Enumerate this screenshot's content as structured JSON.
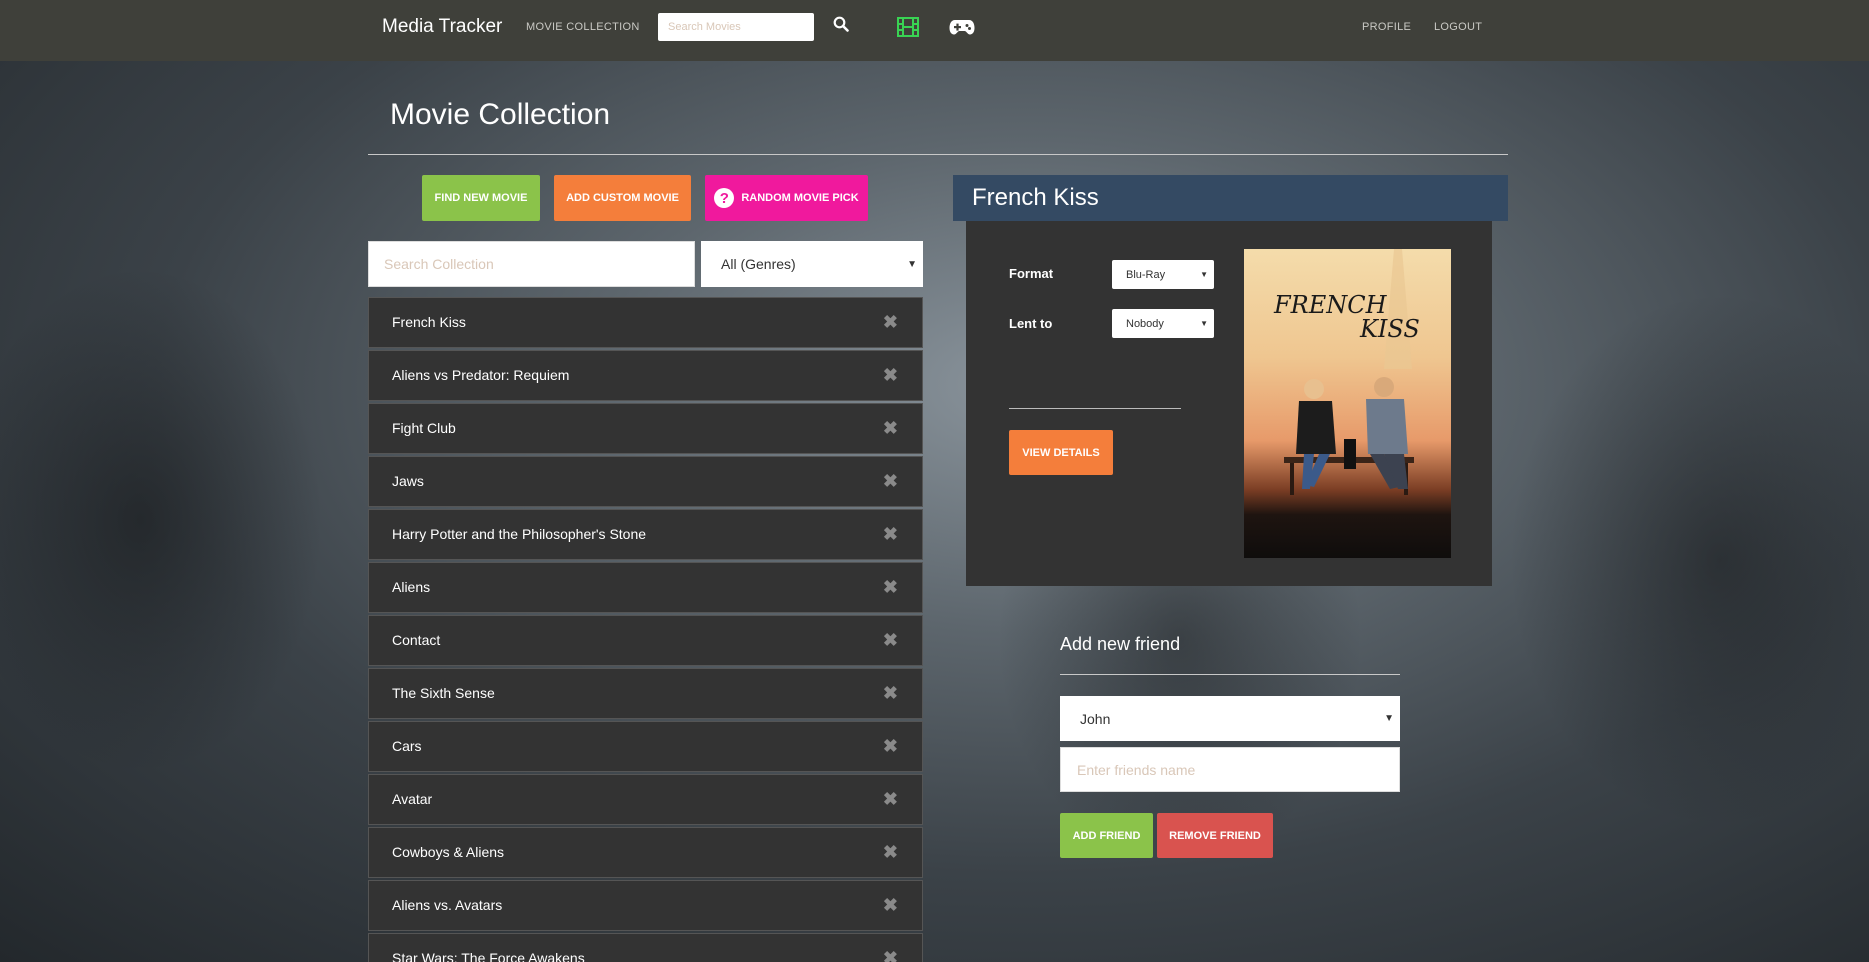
{
  "navbar": {
    "brand": "Media Tracker",
    "movie_collection_link": "MOVIE COLLECTION",
    "search_placeholder": "Search Movies",
    "profile_link": "PROFILE",
    "logout_link": "LOGOUT",
    "icons": [
      "search-icon",
      "film-icon",
      "gamepad-icon"
    ],
    "film_icon_color": "#39d353"
  },
  "page": {
    "title": "Movie Collection"
  },
  "actions": {
    "find_new_movie": "FIND NEW MOVIE",
    "add_custom_movie": "ADD CUSTOM MOVIE",
    "random_movie_pick": "RANDOM MOVIE PICK",
    "random_icon_glyph": "?"
  },
  "collection": {
    "search_placeholder": "Search Collection",
    "genre_selected": "All (Genres)",
    "delete_glyph": "✖",
    "movies": [
      "French Kiss",
      "Aliens vs Predator: Requiem",
      "Fight Club",
      "Jaws",
      "Harry Potter and the Philosopher's Stone",
      "Aliens",
      "Contact",
      "The Sixth Sense",
      "Cars",
      "Avatar",
      "Cowboys & Aliens",
      "Aliens vs. Avatars",
      "Star Wars: The Force Awakens"
    ]
  },
  "detail": {
    "title": "French Kiss",
    "format_label": "Format",
    "format_value": "Blu-Ray",
    "lent_label": "Lent to",
    "lent_value": "Nobody",
    "view_details": "VIEW DETAILS",
    "poster_title_line1": "FRENCH",
    "poster_title_line2": "KISS"
  },
  "friends": {
    "title": "Add new friend",
    "selected_friend": "John",
    "name_placeholder": "Enter friends name",
    "add_button": "ADD FRIEND",
    "remove_button": "REMOVE FRIEND"
  },
  "colors": {
    "navbar": "#3f403a",
    "green": "#8bc34a",
    "orange": "#f47e3b",
    "pink": "#f0199d",
    "red": "#d9534f",
    "detail_header": "#344a63",
    "panel": "#333333"
  }
}
